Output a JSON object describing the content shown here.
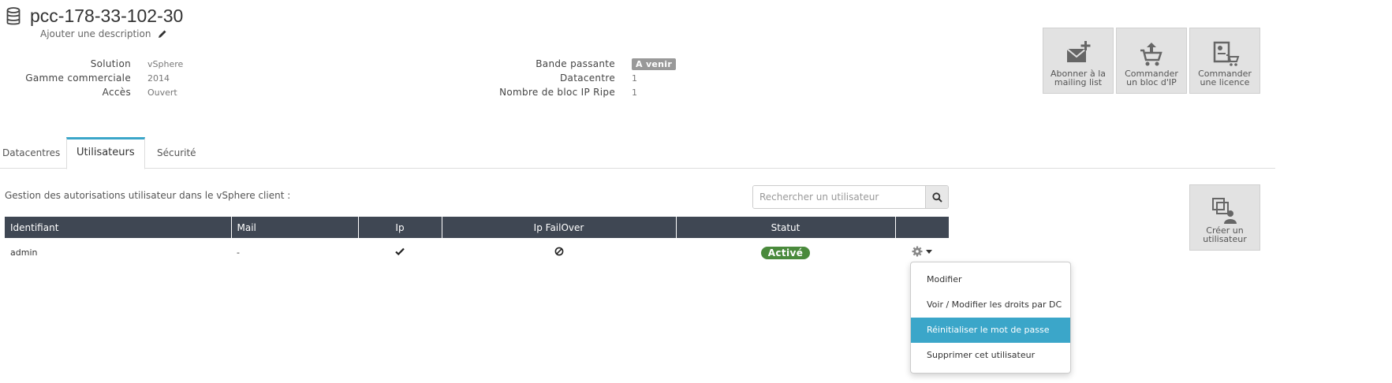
{
  "header": {
    "title": "pcc-178-33-102-30",
    "description_link": "Ajouter une description",
    "db_icon": "database-icon",
    "edit_icon": "pencil-icon"
  },
  "info_left": [
    {
      "label": "Solution",
      "value": "vSphere"
    },
    {
      "label": "Gamme commerciale",
      "value": "2014"
    },
    {
      "label": "Accès",
      "value": "Ouvert"
    }
  ],
  "info_right": [
    {
      "label": "Bande passante",
      "value": "A venir"
    },
    {
      "label": "Datacentre",
      "value": "1"
    },
    {
      "label": "Nombre de bloc IP Ripe",
      "value": "1"
    }
  ],
  "actions": [
    {
      "label": "Abonner à la mailing list",
      "icon": "envelope-plus-icon"
    },
    {
      "label": "Commander un bloc d'IP",
      "icon": "cart-icon"
    },
    {
      "label": "Commander une licence",
      "icon": "license-cart-icon"
    }
  ],
  "tabs": [
    {
      "label": "Datacentres",
      "active": false
    },
    {
      "label": "Utilisateurs",
      "active": true
    },
    {
      "label": "Sécurité",
      "active": false
    }
  ],
  "users_panel": {
    "description": "Gestion des autorisations utilisateur dans le vSphere client :",
    "search_placeholder": "Rechercher un utilisateur",
    "search_icon": "search-icon",
    "create_user_label": "Créer un utilisateur",
    "create_user_icon": "add-user-icon"
  },
  "table": {
    "columns": [
      "Identifiant",
      "Mail",
      "Ip",
      "Ip FailOver",
      "Statut",
      ""
    ],
    "rows": [
      {
        "identifiant": "admin",
        "mail": "-",
        "ip": "check-icon",
        "ip_failover": "ban-icon",
        "statut": "Activé",
        "actions_icon": "gear-icon"
      }
    ]
  },
  "row_menu": {
    "items": [
      {
        "label": "Modifier",
        "highlighted": false
      },
      {
        "label": "Voir / Modifier les droits par DC",
        "highlighted": false
      },
      {
        "label": "Réinitialiser le mot de passe",
        "highlighted": true
      },
      {
        "label": "Supprimer cet utilisateur",
        "highlighted": false
      }
    ]
  },
  "colors": {
    "accent": "#3ba6c9",
    "table_header": "#3f4753",
    "status_active": "#4a8a3c",
    "badge_grey": "#999999",
    "tile_bg": "#e2e2e2"
  }
}
